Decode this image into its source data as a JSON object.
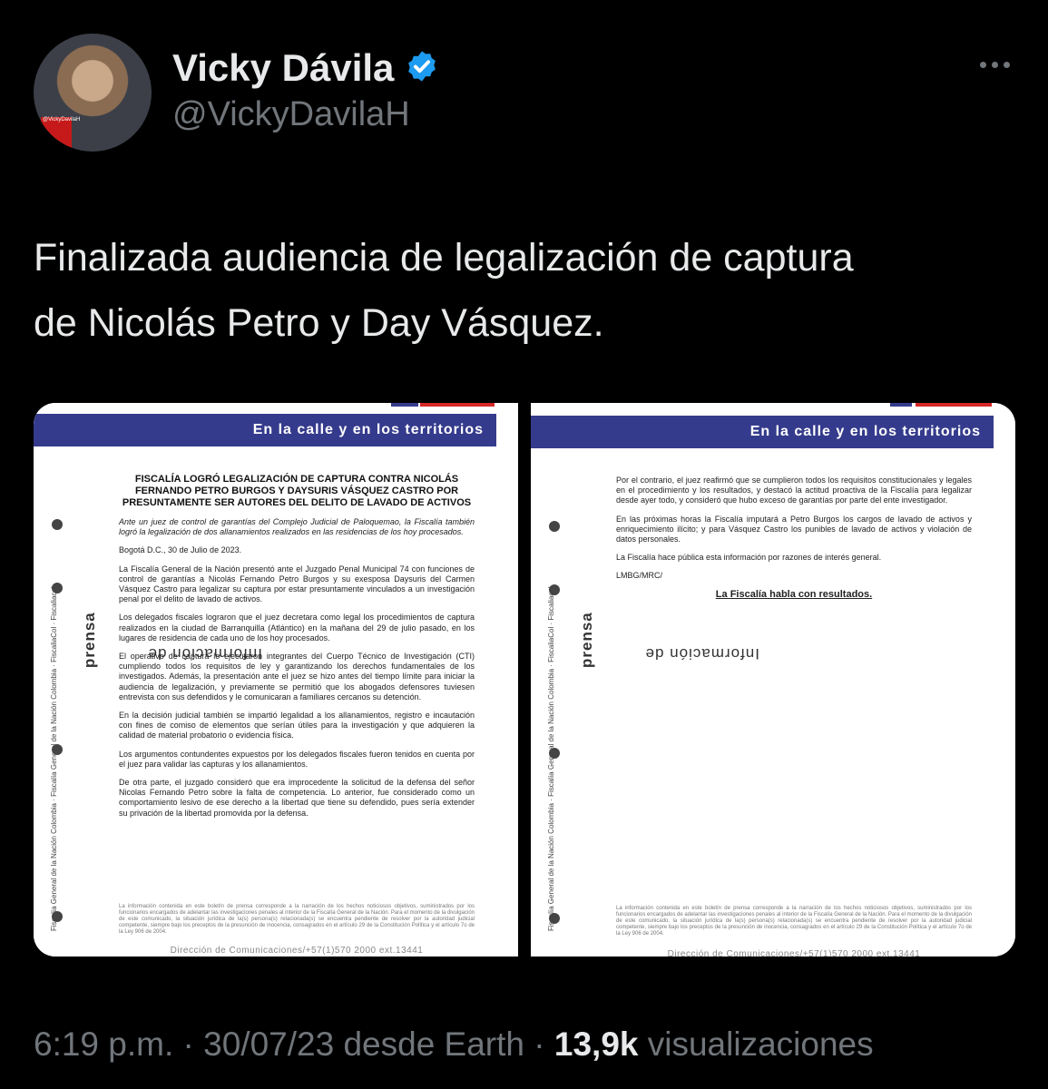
{
  "author": {
    "name": "Vicky Dávila",
    "handle": "@VickyDavilaH",
    "avatar_caption": "@VickyDavilaH"
  },
  "tweet": {
    "text_line1": "Finalizada audiencia de legalización de captura",
    "text_line2": "de Nicolás Petro y Day Vásquez."
  },
  "colors": {
    "background": "#000000",
    "verified": "#1d9bf0",
    "band": "#353b8c"
  },
  "doc": {
    "band_text": "En la calle y en los territorios",
    "side_label_prefix": "Información de ",
    "side_label_bold": "prensa",
    "side_org": "Fiscalía General de la Nación Colombia   ·   Fiscalía General de la Nación Colombia   ·   FiscaliaCol   ·   Fiscaliacol",
    "title": "FISCALÍA LOGRÓ LEGALIZACIÓN DE CAPTURA CONTRA NICOLÁS FERNANDO PETRO BURGOS Y DAYSURIS VÁSQUEZ CASTRO POR PRESUNTAMENTE SER AUTORES DEL DELITO DE LAVADO DE ACTIVOS",
    "lead": "Ante un juez de control de garantías del Complejo Judicial de Paloquemao, la Fiscalía también logró la legalización de dos allanamientos realizados en las residencias de los hoy procesados.",
    "date": "Bogotá D.C., 30 de Julio de 2023.",
    "p1": "La Fiscalía General de la Nación presentó ante el Juzgado Penal Municipal 74 con funciones de control de garantías a Nicolás Fernando Petro Burgos y su exesposa Daysuris del Carmen Vásquez Castro para legalizar su captura por estar presuntamente vinculados a un investigación penal por el delito de lavado de activos.",
    "p2": "Los delegados fiscales lograron que el juez decretara como legal los procedimientos de captura realizados en la ciudad de Barranquilla (Atlántico) en la mañana del 29 de julio pasado, en los lugares de residencia de cada uno de los hoy procesados.",
    "p3": "El operativo de captura lo ejecutaron integrantes del Cuerpo Técnico de Investigación (CTI) cumpliendo todos los requisitos de ley y garantizando los derechos fundamentales de los investigados. Además, la presentación ante el juez se hizo antes del tiempo límite para iniciar la audiencia de legalización, y previamente se permitió que los abogados defensores tuviesen entrevista con sus defendidos y le comunicaran a familiares cercanos su detención.",
    "p4": "En la decisión judicial también se impartió legalidad a los allanamientos, registro e incautación con fines de comiso de elementos que serían útiles para la investigación y que adquieren la calidad de material probatorio o evidencia física.",
    "p5": "Los argumentos contundentes expuestos por los delegados fiscales fueron tenidos en cuenta por el juez para validar las capturas y los allanamientos.",
    "p6": "De otra parte, el juzgado consideró que era improcedente la solicitud de la defensa del señor Nicolas Fernando Petro sobre la falta de competencia. Lo anterior, fue considerado como un comportamiento lesivo de ese derecho a la libertad que tiene su defendido, pues sería extender su privación de la libertad promovida por la defensa.",
    "p7": "Por el contrario, el juez reafirmó que se cumplieron todos los requisitos constitucionales y legales en el procedimiento y los resultados, y destacó la actitud proactiva de la Fiscalía para legalizar desde ayer todo, y consideró que hubo exceso de garantías por parte del ente investigador.",
    "p8": "En las próximas horas la Fiscalía imputará a Petro Burgos los cargos de lavado de activos y enriquecimiento ilícito; y para Vásquez Castro los punibles de lavado de activos y violación de datos personales.",
    "p9": "La Fiscalía hace pública esta información por razones de interés general.",
    "initials": "LMBG/MRC/",
    "closing": "La Fiscalía habla con resultados.",
    "disclaimer": "La información contenida en este boletín de prensa corresponde a la narración de los hechos noticiosos objetivos, suministrados por los funcionarios encargados de adelantar las investigaciones penales al interior de la Fiscalía General de la Nación. Para el momento de la divulgación de este comunicado, la situación jurídica de la(s) persona(s) relacionada(s) se encuentra pendiente de resolver por la autoridad judicial competente, siempre bajo los preceptos de la presunción de inocencia, consagrados en el artículo 29 de la Constitución Política y el artículo 7o de la Ley 906 de 2004.",
    "footer": "Dirección de Comunicaciones/+57(1)570 2000 ext.13441"
  },
  "meta": {
    "time": "6:19 p.m.",
    "sep1": " · ",
    "date_source": "30/07/23 desde Earth",
    "sep2": " · ",
    "views": "13,9k",
    "views_label": " visualizaciones"
  }
}
